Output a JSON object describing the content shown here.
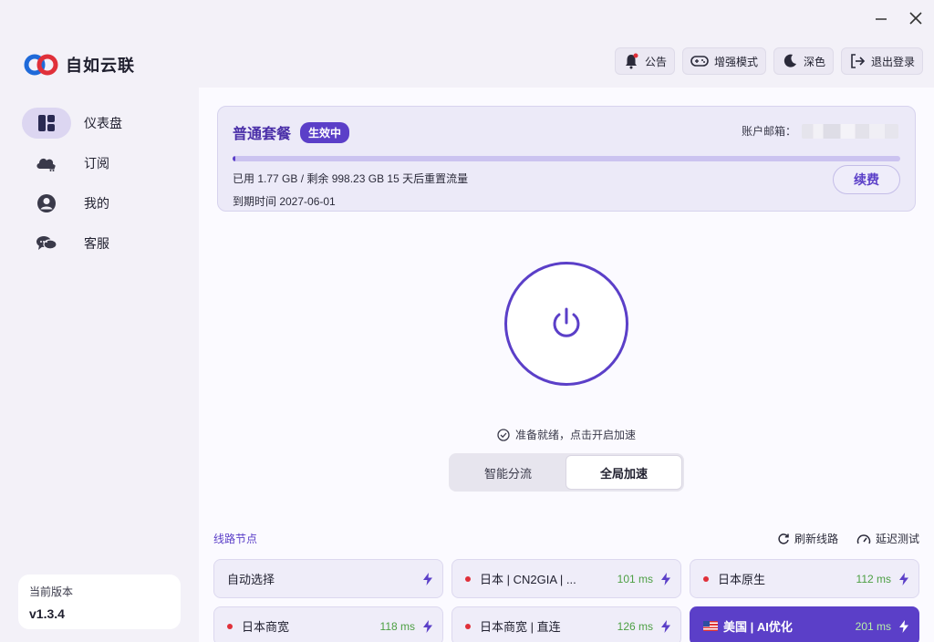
{
  "window": {
    "minimize_icon": "minimize-icon",
    "close_icon": "close-icon"
  },
  "brand": {
    "name": "自如云联",
    "logo_icon": "chain-link-logo"
  },
  "sidebar": {
    "items": [
      {
        "label": "仪表盘",
        "icon": "dashboard-icon",
        "active": true
      },
      {
        "label": "订阅",
        "icon": "cloud-cart-icon",
        "active": false
      },
      {
        "label": "我的",
        "icon": "user-icon",
        "active": false
      },
      {
        "label": "客服",
        "icon": "chat-icon",
        "active": false
      }
    ],
    "version_label": "当前版本",
    "version_value": "v1.3.4"
  },
  "toolbar": {
    "notice": "公告",
    "enhanced_mode": "增强模式",
    "dark": "深色",
    "logout": "退出登录"
  },
  "plan": {
    "title": "普通套餐",
    "badge": "生效中",
    "email_label": "账户邮箱：",
    "usage_text": "已用 1.77 GB / 剩余 998.23 GB   15 天后重置流量",
    "expire_text": "到期时间 2027-06-01",
    "renew_label": "续费",
    "used_fraction": 0.0018,
    "progress_color": "#5b3fc8"
  },
  "power": {
    "icon": "power-icon"
  },
  "status": {
    "text": "准备就绪，点击开启加速",
    "icon": "check-circle-icon"
  },
  "mode": {
    "options": [
      "智能分流",
      "全局加速"
    ],
    "selected": "全局加速"
  },
  "nodes": {
    "title": "线路节点",
    "refresh_label": "刷新线路",
    "latency_test_label": "延迟测试",
    "items": [
      {
        "name": "自动选择",
        "latency": "",
        "dot": false,
        "flag": false,
        "selected": false
      },
      {
        "name": "日本 | CN2GIA | ...",
        "latency": "101 ms",
        "dot": true,
        "flag": false,
        "selected": false
      },
      {
        "name": "日本原生",
        "latency": "112 ms",
        "dot": true,
        "flag": false,
        "selected": false
      },
      {
        "name": "日本商宽",
        "latency": "118 ms",
        "dot": true,
        "flag": false,
        "selected": false
      },
      {
        "name": "日本商宽 | 直连",
        "latency": "126 ms",
        "dot": true,
        "flag": false,
        "selected": false
      },
      {
        "name": "美国 | AI优化",
        "latency": "201 ms",
        "dot": false,
        "flag": true,
        "selected": true
      }
    ]
  },
  "colors": {
    "accent": "#5b3fc8",
    "latency_green": "#4c9f43",
    "status_red": "#e0303a"
  }
}
